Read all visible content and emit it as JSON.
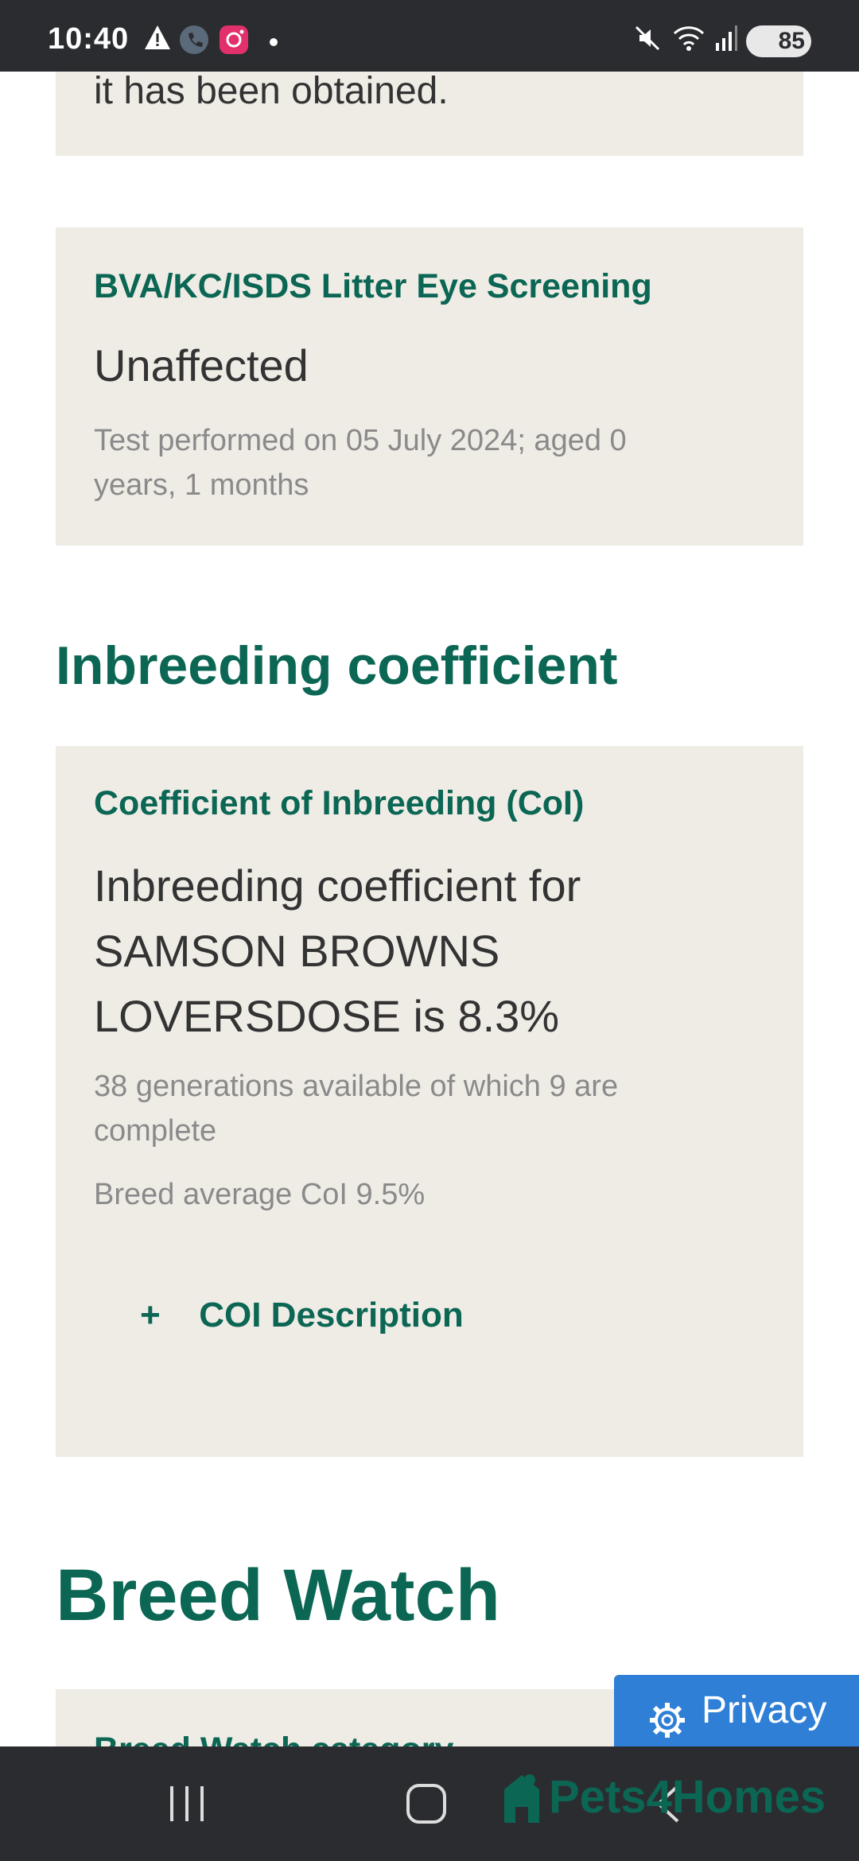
{
  "status_bar": {
    "time": "10:40",
    "battery": "85",
    "icons": [
      "alert-triangle-icon",
      "phone-icon",
      "instagram-icon",
      "dot-icon",
      "mute-icon",
      "wifi-icon",
      "signal-icon",
      "battery-icon"
    ]
  },
  "top_card": {
    "text": "it has been obtained."
  },
  "eye_card": {
    "title": "BVA/KC/ISDS Litter Eye Screening",
    "result": "Unaffected",
    "note_line1": "Test performed on 05 July 2024; aged 0",
    "note_line2": "years, 1 months"
  },
  "inbreeding_section": {
    "heading": "Inbreeding coefficient"
  },
  "coi_card": {
    "title": "Coefficient of Inbreeding (CoI)",
    "value_line1": "Inbreeding coefficient for",
    "value_line2": "SAMSON BROWNS",
    "value_line3": "LOVERSDOSE is 8.3%",
    "generations_line1": "38 generations available of which 9 are",
    "generations_line2": "complete",
    "breed_average": "Breed average CoI 9.5%",
    "expander_symbol": "+",
    "expander_label": "COI Description"
  },
  "breed_watch": {
    "heading": "Breed Watch",
    "card_title_partial": "Breed Watch category"
  },
  "privacy_button": {
    "label": "Privacy"
  },
  "nav": {
    "brand": "Pets4Homes"
  },
  "colors": {
    "accent_green": "#0b6654",
    "card_bg": "#efece6",
    "privacy_blue": "#2f7fd6",
    "system_bar": "#2b2c30"
  }
}
